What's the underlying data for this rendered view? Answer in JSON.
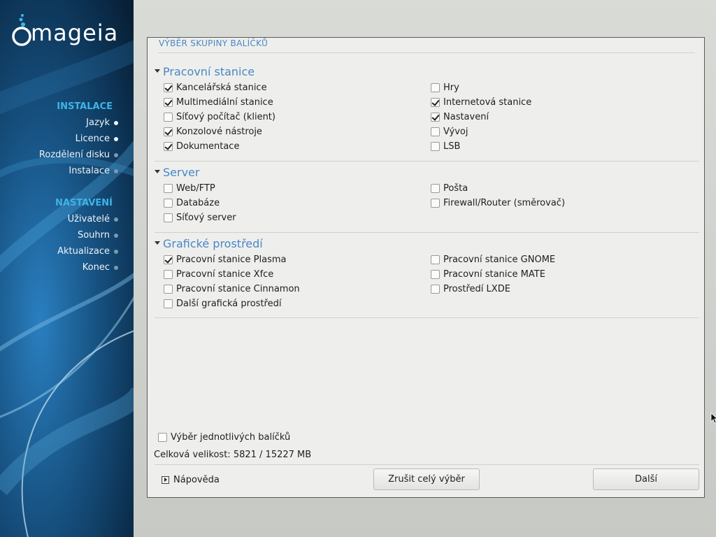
{
  "sidebar": {
    "logo_text": "mageia",
    "sections": [
      {
        "label": "INSTALACE",
        "items": [
          {
            "label": "Jazyk",
            "state": "done"
          },
          {
            "label": "Licence",
            "state": "done"
          },
          {
            "label": "Rozdělení disku",
            "state": "todo"
          },
          {
            "label": "Instalace",
            "state": "todo"
          }
        ]
      },
      {
        "label": "NASTAVENÍ",
        "items": [
          {
            "label": "Uživatelé",
            "state": "todo"
          },
          {
            "label": "Souhrn",
            "state": "todo"
          },
          {
            "label": "Aktualizace",
            "state": "todo"
          },
          {
            "label": "Konec",
            "state": "todo"
          }
        ]
      }
    ]
  },
  "dialog": {
    "title": "VÝBĚR SKUPINY BALÍČKŮ",
    "groups": [
      {
        "title": "Pracovní stanice",
        "left": [
          {
            "label": "Kancelářská stanice",
            "checked": true
          },
          {
            "label": "Multimediální stanice",
            "checked": true
          },
          {
            "label": "Síťový počítač (klient)",
            "checked": false
          },
          {
            "label": "Konzolové nástroje",
            "checked": true
          },
          {
            "label": "Dokumentace",
            "checked": true
          }
        ],
        "right": [
          {
            "label": "Hry",
            "checked": false
          },
          {
            "label": "Internetová stanice",
            "checked": true
          },
          {
            "label": "Nastavení",
            "checked": true
          },
          {
            "label": "Vývoj",
            "checked": false
          },
          {
            "label": "LSB",
            "checked": false
          }
        ]
      },
      {
        "title": "Server",
        "left": [
          {
            "label": "Web/FTP",
            "checked": false
          },
          {
            "label": "Databáze",
            "checked": false
          },
          {
            "label": "Síťový server",
            "checked": false
          }
        ],
        "right": [
          {
            "label": "Pošta",
            "checked": false
          },
          {
            "label": "Firewall/Router (směrovač)",
            "checked": false
          }
        ]
      },
      {
        "title": "Grafické prostředí",
        "left": [
          {
            "label": "Pracovní stanice Plasma",
            "checked": true
          },
          {
            "label": "Pracovní stanice Xfce",
            "checked": false
          },
          {
            "label": "Pracovní stanice Cinnamon",
            "checked": false
          },
          {
            "label": "Další grafická prostředí",
            "checked": false
          }
        ],
        "right": [
          {
            "label": "Pracovní stanice GNOME",
            "checked": false
          },
          {
            "label": "Pracovní stanice MATE",
            "checked": false
          },
          {
            "label": "Prostředí LXDE",
            "checked": false
          }
        ]
      }
    ],
    "individual_select": {
      "label": "Výběr jednotlivých balíčků",
      "checked": false
    },
    "total_size": "Celková velikost: 5821 / 15227 MB",
    "help_label": "Nápověda",
    "clear_button": "Zrušit celý výběr",
    "next_button": "Další"
  }
}
